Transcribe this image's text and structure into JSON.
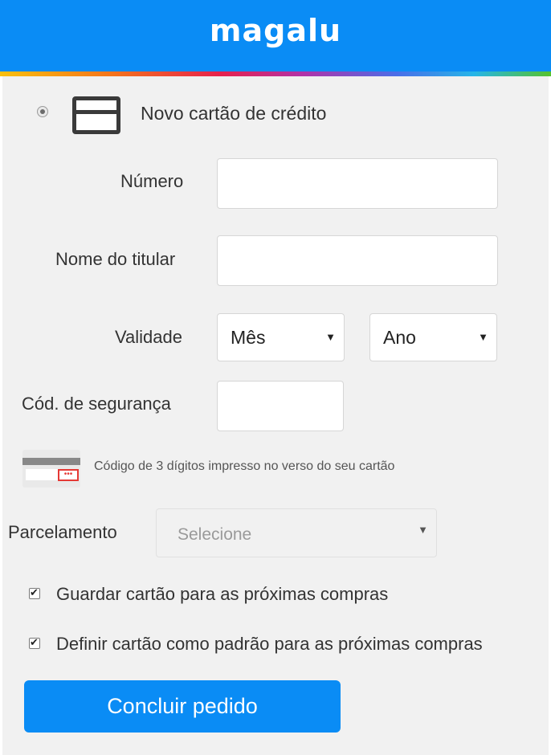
{
  "header": {
    "logo_text": "magalu",
    "bg": "#0a8cf5"
  },
  "payment_option": {
    "title": "Novo cartão de crédito",
    "selected": true
  },
  "form": {
    "number_label": "Número",
    "name_label": "Nome do titular",
    "expiry_label": "Validade",
    "month_value": "Mês",
    "year_value": "Ano",
    "cvv_label": "Cód. de segurança",
    "cvv_hint": "Código de 3 dígitos impresso no verso do seu cartão",
    "cvv_icon_text": "•••"
  },
  "installments": {
    "label": "Parcelamento",
    "placeholder": "Selecione"
  },
  "options": {
    "save_card": {
      "label": "Guardar cartão para as próximas compras",
      "checked": true
    },
    "default_card": {
      "label": "Definir cartão como padrão para as próximas compras",
      "checked": true
    }
  },
  "submit": {
    "label": "Concluir pedido"
  },
  "icons": {
    "dropdown": "▼"
  }
}
